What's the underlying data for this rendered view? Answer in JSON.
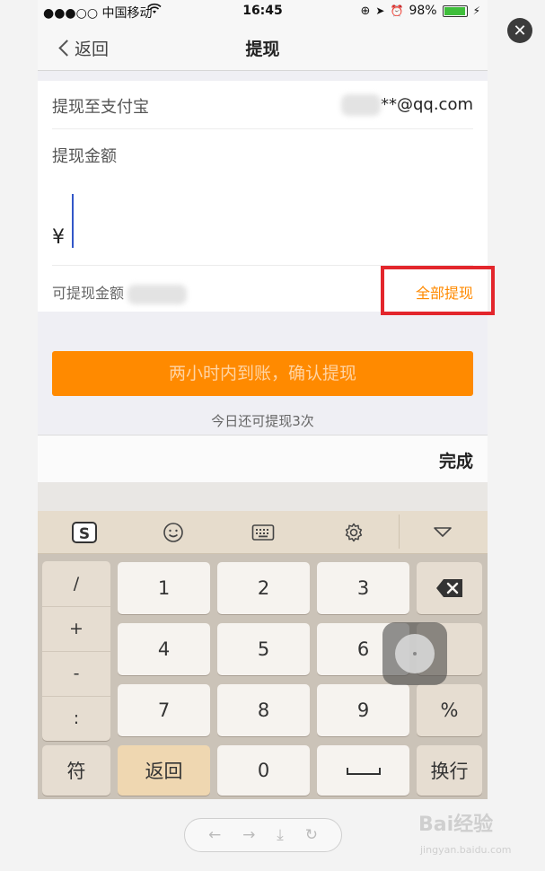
{
  "status_bar": {
    "carrier": "●●●○○ 中国移动",
    "time": "16:45",
    "battery": "98%",
    "battery_level": 0.98
  },
  "nav": {
    "back_label": "返回",
    "title": "提现"
  },
  "withdraw": {
    "destination_label": "提现至支付宝",
    "account": "**@qq.com",
    "amount_label": "提现金额",
    "currency_symbol": "¥",
    "available_label": "可提现金额",
    "withdraw_all_label": "全部提现"
  },
  "confirm_button": "两小时内到账，确认提现",
  "remaining_text": "今日还可提现3次",
  "done_label": "完成",
  "keyboard": {
    "symbols": [
      "/",
      "+",
      "-",
      ":"
    ],
    "digits": [
      "1",
      "2",
      "3",
      "4",
      "5",
      "6",
      "7",
      "8",
      "9",
      "0"
    ],
    "percent": "%",
    "fu": "符",
    "return": "返回",
    "newline": "换行"
  },
  "watermark": {
    "brand": "Bai经验",
    "url": "jingyan.baidu.com"
  },
  "colors": {
    "accent": "#ff8a00",
    "highlight": "#e3262c",
    "cursor": "#3257c8"
  }
}
